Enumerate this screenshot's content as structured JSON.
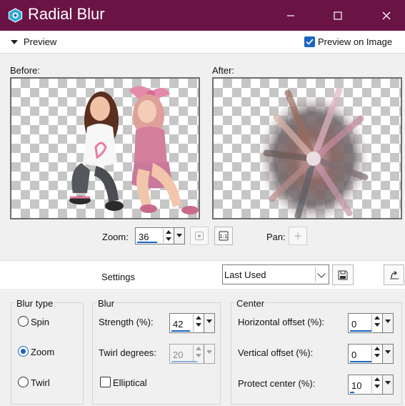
{
  "window": {
    "title": "Radial Blur"
  },
  "preview": {
    "toggle_label": "Preview",
    "preview_on_image_label": "Preview on Image",
    "preview_on_image_checked": true,
    "before_label": "Before:",
    "after_label": "After:",
    "zoom_label": "Zoom:",
    "zoom_value": "36",
    "pan_label": "Pan:"
  },
  "settings": {
    "label": "Settings",
    "preset_value": "Last Used"
  },
  "blur_type": {
    "title": "Blur type",
    "options": [
      {
        "label": "Spin",
        "selected": false
      },
      {
        "label": "Zoom",
        "selected": true
      },
      {
        "label": "Twirl",
        "selected": false
      }
    ]
  },
  "blur": {
    "title": "Blur",
    "strength_label": "Strength (%):",
    "strength_value": "42",
    "twirl_label": "Twirl degrees:",
    "twirl_value": "20",
    "twirl_enabled": false,
    "elliptical_label": "Elliptical",
    "elliptical_checked": false
  },
  "center": {
    "title": "Center",
    "h_offset_label": "Horizontal offset (%):",
    "h_offset_value": "0",
    "v_offset_label": "Vertical offset (%):",
    "v_offset_value": "0",
    "protect_label": "Protect center (%):",
    "protect_value": "10"
  },
  "colors": {
    "titlebar": "#6a1445",
    "accent": "#1b63c4"
  }
}
